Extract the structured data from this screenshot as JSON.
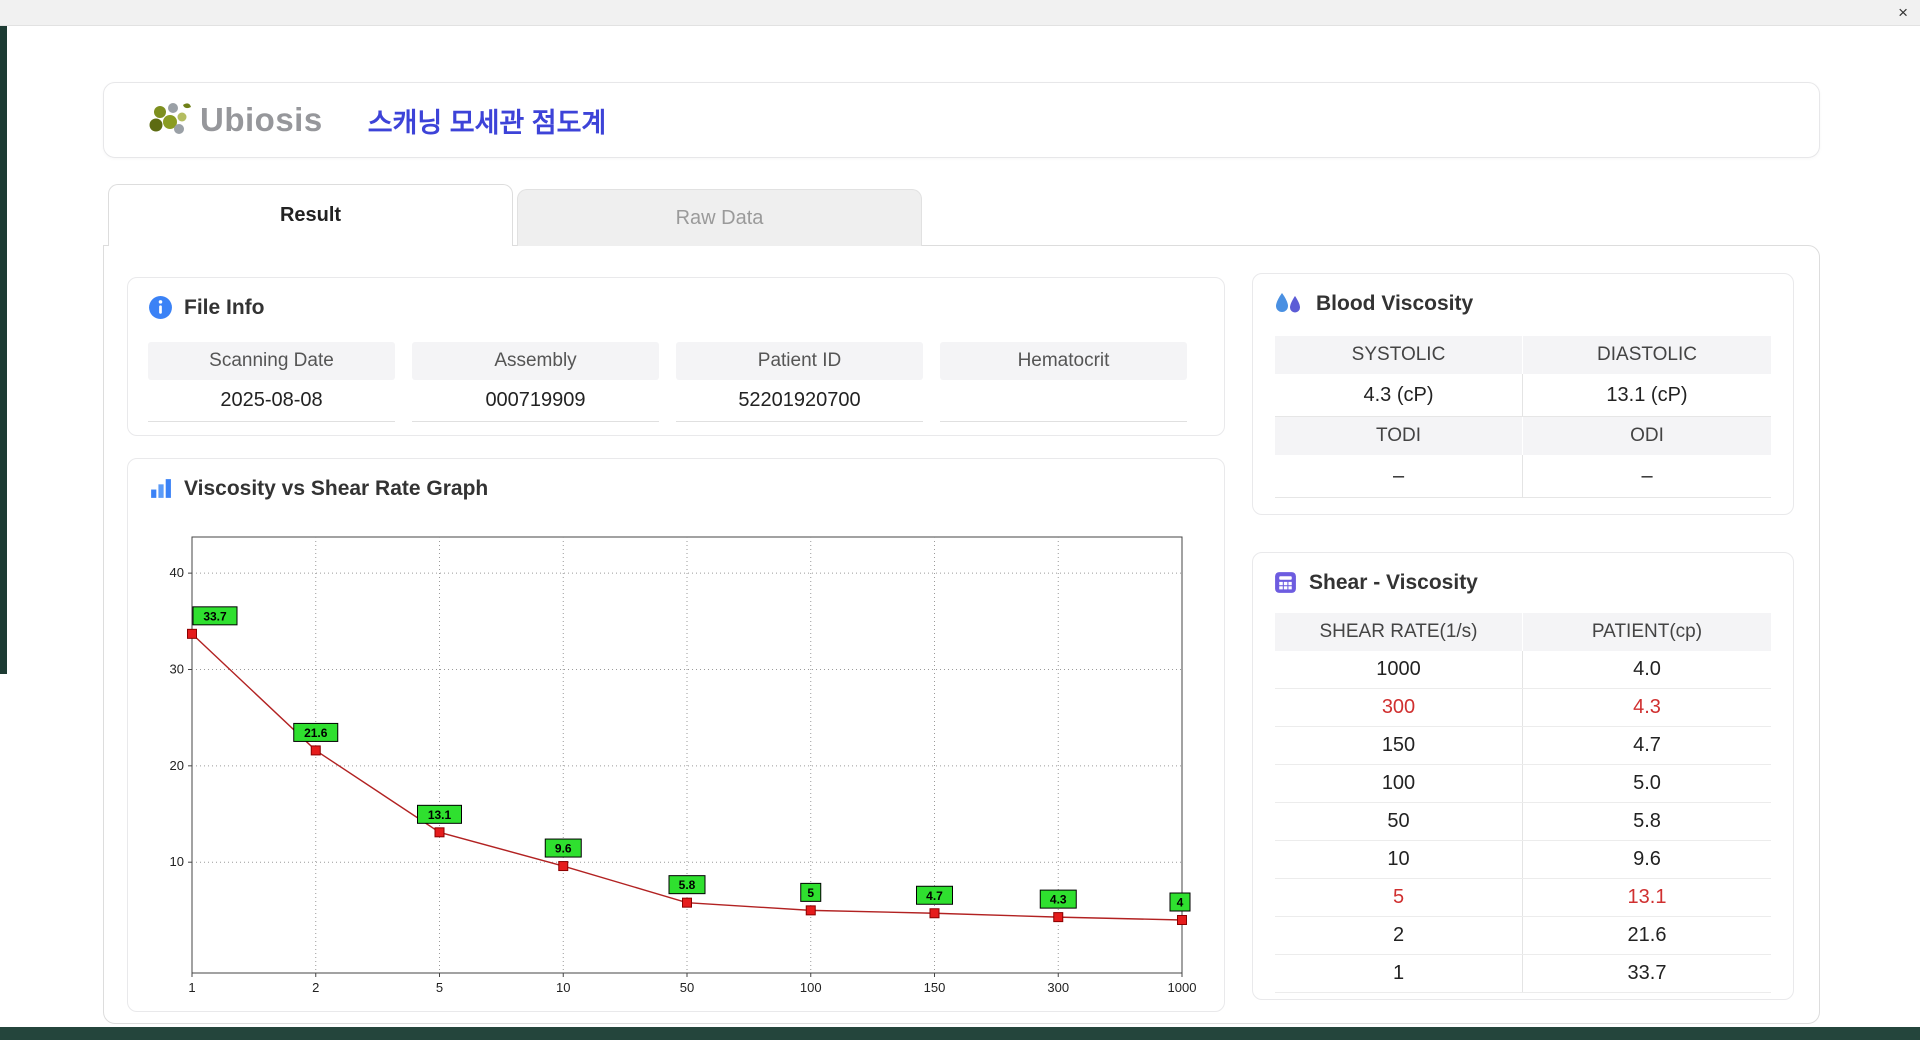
{
  "window": {
    "close_label": "×"
  },
  "header": {
    "logo_text": "Ubiosis",
    "title": "스캐닝 모세관 점도계"
  },
  "tabs": [
    {
      "label": "Result",
      "active": true
    },
    {
      "label": "Raw Data",
      "active": false
    }
  ],
  "file_info": {
    "title": "File Info",
    "fields": [
      {
        "label": "Scanning Date",
        "value": "2025-08-08"
      },
      {
        "label": "Assembly",
        "value": "000719909"
      },
      {
        "label": "Patient ID",
        "value": "52201920700"
      },
      {
        "label": "Hematocrit",
        "value": ""
      }
    ]
  },
  "graph": {
    "title": "Viscosity vs Shear Rate Graph"
  },
  "chart_data": {
    "type": "line",
    "title": "Viscosity vs Shear Rate Graph",
    "xlabel": "",
    "ylabel": "",
    "x": [
      1,
      2,
      5,
      10,
      50,
      100,
      150,
      300,
      1000
    ],
    "x_tick_labels": [
      "1",
      "2",
      "5",
      "10",
      "50",
      "100",
      "150",
      "300",
      "1000"
    ],
    "values": [
      33.7,
      21.6,
      13.1,
      9.6,
      5.8,
      5,
      4.7,
      4.3,
      4
    ],
    "point_labels": [
      "33.7",
      "21.6",
      "13.1",
      "9.6",
      "5.8",
      "5",
      "4.7",
      "4.3",
      "4"
    ],
    "y_ticks": [
      10,
      20,
      30,
      40
    ],
    "ylim": [
      -1.5,
      43.75
    ],
    "x_axis_type": "log-category",
    "grid": true,
    "legend": false,
    "line_color": "#b22222",
    "marker_color": "#e51c1c",
    "marker_edge_color": "#8a0000",
    "label_bg": "#2fe02f",
    "label_border": "#000000"
  },
  "blood_viscosity": {
    "title": "Blood Viscosity",
    "rows": [
      {
        "h1": "SYSTOLIC",
        "h2": "DIASTOLIC",
        "v1": "4.3 (cP)",
        "v2": "13.1 (cP)"
      },
      {
        "h1": "TODI",
        "h2": "ODI",
        "v1": "–",
        "v2": "–"
      }
    ]
  },
  "shear_viscosity": {
    "title": "Shear - Viscosity",
    "columns": [
      "SHEAR RATE(1/s)",
      "PATIENT(cp)"
    ],
    "rows": [
      {
        "rate": "1000",
        "patient": "4.0",
        "highlight": false
      },
      {
        "rate": "300",
        "patient": "4.3",
        "highlight": true
      },
      {
        "rate": "150",
        "patient": "4.7",
        "highlight": false
      },
      {
        "rate": "100",
        "patient": "5.0",
        "highlight": false
      },
      {
        "rate": "50",
        "patient": "5.8",
        "highlight": false
      },
      {
        "rate": "10",
        "patient": "9.6",
        "highlight": false
      },
      {
        "rate": "5",
        "patient": "13.1",
        "highlight": true
      },
      {
        "rate": "2",
        "patient": "21.6",
        "highlight": false
      },
      {
        "rate": "1",
        "patient": "33.7",
        "highlight": false
      }
    ]
  },
  "colors": {
    "accent_blue": "#3b82f6",
    "title_blue": "#3d43d8",
    "highlight_red": "#d03030",
    "edge_teal": "#24453c"
  }
}
